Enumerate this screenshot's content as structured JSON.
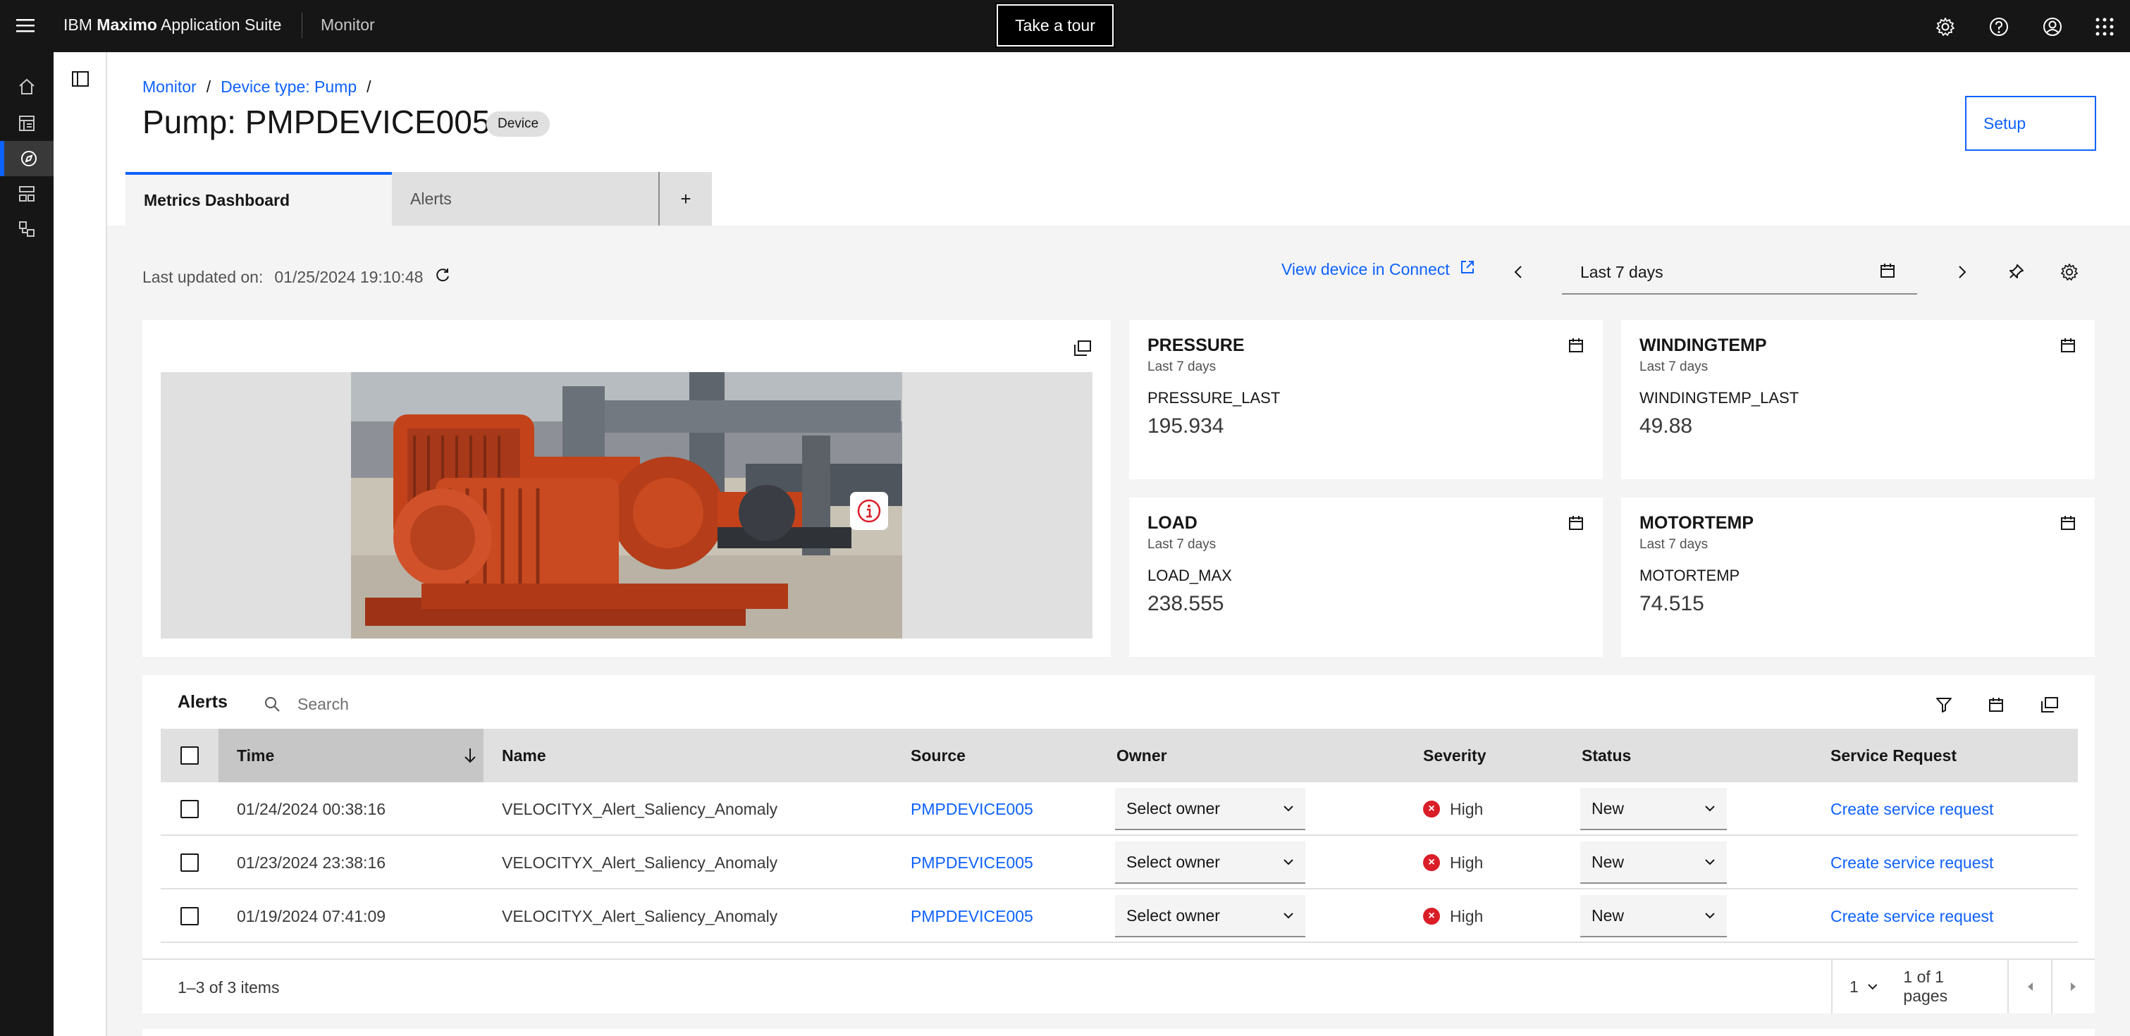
{
  "topbar": {
    "brand_prefix": "IBM",
    "brand_bold": "Maximo",
    "brand_suffix": "Application Suite",
    "app_name": "Monitor",
    "tour_label": "Take a tour"
  },
  "breadcrumb": {
    "items": [
      "Monitor",
      "Device type: Pump"
    ],
    "separator": "/"
  },
  "page": {
    "title": "Pump: PMPDEVICE005",
    "tag": "Device",
    "setup_label": "Setup"
  },
  "tabs": [
    {
      "label": "Metrics Dashboard",
      "active": true
    },
    {
      "label": "Alerts",
      "active": false
    },
    {
      "label": "+",
      "active": false
    }
  ],
  "toolbar": {
    "last_updated_label": "Last updated on:",
    "last_updated_value": "01/25/2024 19:10:48",
    "connect_link": "View device in Connect",
    "date_range": "Last 7 days"
  },
  "metrics": [
    {
      "title": "PRESSURE",
      "period": "Last 7 days",
      "label": "PRESSURE_LAST",
      "value": "195.934"
    },
    {
      "title": "WINDINGTEMP",
      "period": "Last 7 days",
      "label": "WINDINGTEMP_LAST",
      "value": "49.88"
    },
    {
      "title": "LOAD",
      "period": "Last 7 days",
      "label": "LOAD_MAX",
      "value": "238.555"
    },
    {
      "title": "MOTORTEMP",
      "period": "Last 7 days",
      "label": "MOTORTEMP",
      "value": "74.515"
    }
  ],
  "alerts": {
    "title": "Alerts",
    "search_placeholder": "Search",
    "columns": [
      "Time",
      "Name",
      "Source",
      "Owner",
      "Severity",
      "Status",
      "Service Request"
    ],
    "rows": [
      {
        "time": "01/24/2024 00:38:16",
        "name": "VELOCITYX_Alert_Saliency_Anomaly",
        "source": "PMPDEVICE005",
        "owner": "Select owner",
        "severity": "High",
        "status": "New",
        "service": "Create service request"
      },
      {
        "time": "01/23/2024 23:38:16",
        "name": "VELOCITYX_Alert_Saliency_Anomaly",
        "source": "PMPDEVICE005",
        "owner": "Select owner",
        "severity": "High",
        "status": "New",
        "service": "Create service request"
      },
      {
        "time": "01/19/2024 07:41:09",
        "name": "VELOCITYX_Alert_Saliency_Anomaly",
        "source": "PMPDEVICE005",
        "owner": "Select owner",
        "severity": "High",
        "status": "New",
        "service": "Create service request"
      }
    ],
    "pagination": {
      "items_text": "1–3 of 3 items",
      "page": "1",
      "pages_text": "1 of 1 pages"
    }
  },
  "colors": {
    "accent": "#0f62fe",
    "topbar": "#161616",
    "severity_high": "#da1e28",
    "pump_orange": "#c4421a"
  }
}
